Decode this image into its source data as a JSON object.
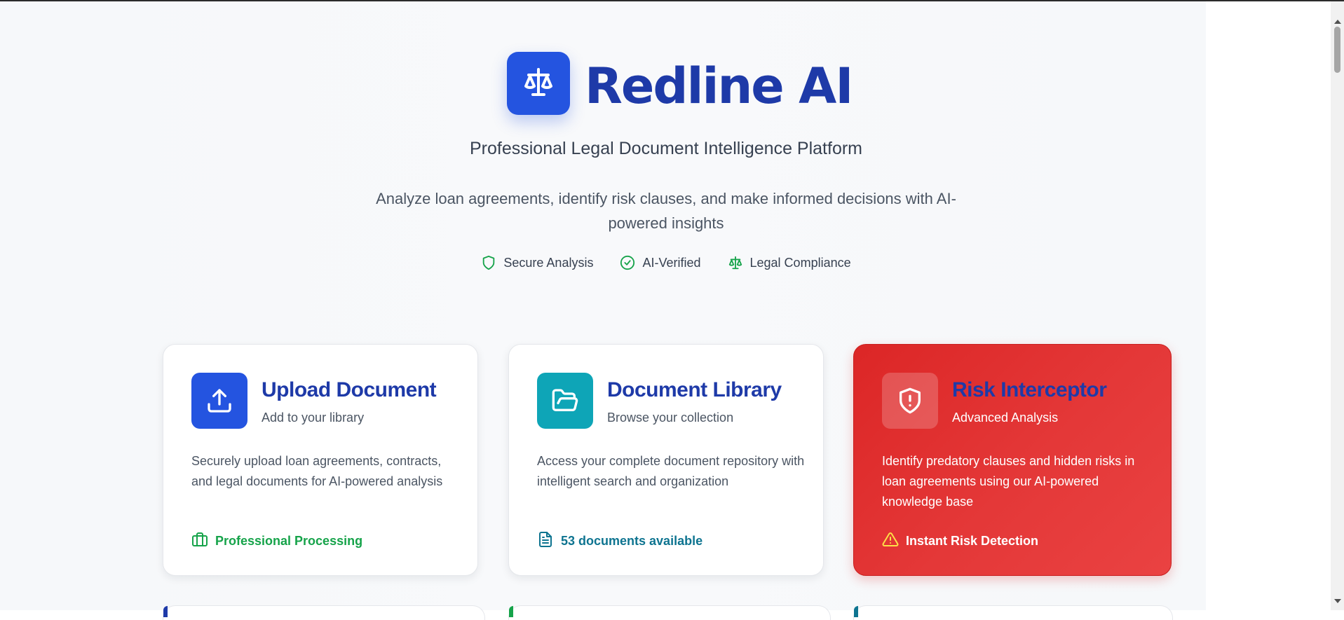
{
  "app": {
    "title": "Redline AI",
    "tagline": "Professional Legal Document Intelligence Platform",
    "description": "Analyze loan agreements, identify risk clauses, and make informed decisions with AI-powered insights",
    "logo_icon": "scale-icon"
  },
  "features": [
    {
      "label": "Secure Analysis",
      "icon": "shield-icon"
    },
    {
      "label": "AI-Verified",
      "icon": "check-circle-icon"
    },
    {
      "label": "Legal Compliance",
      "icon": "scale-icon"
    }
  ],
  "cards": {
    "upload": {
      "title": "Upload Document",
      "subtitle": "Add to your library",
      "description": "Securely upload loan agreements, contracts, and legal documents for AI-powered analysis",
      "footer": "Professional Processing",
      "icon": "upload-icon",
      "footer_icon": "briefcase-icon"
    },
    "library": {
      "title": "Document Library",
      "subtitle": "Browse your collection",
      "description": "Access your complete document repository with intelligent search and organization",
      "footer": "53 documents available",
      "icon": "folder-open-icon",
      "footer_icon": "file-text-icon"
    },
    "risk": {
      "title": "Risk Interceptor",
      "subtitle": "Advanced Analysis",
      "description": "Identify predatory clauses and hidden risks in loan agreements using our AI-powered knowledge base",
      "footer": "Instant Risk Detection",
      "icon": "shield-alert-icon",
      "footer_icon": "warning-triangle-icon"
    }
  },
  "colors": {
    "brand_blue": "#2454e0",
    "title_navy": "#1e3aa8",
    "teal": "#0ea5b7",
    "risk_red": "#dc2626",
    "success_green": "#16a34a",
    "warning_yellow": "#fde047"
  }
}
